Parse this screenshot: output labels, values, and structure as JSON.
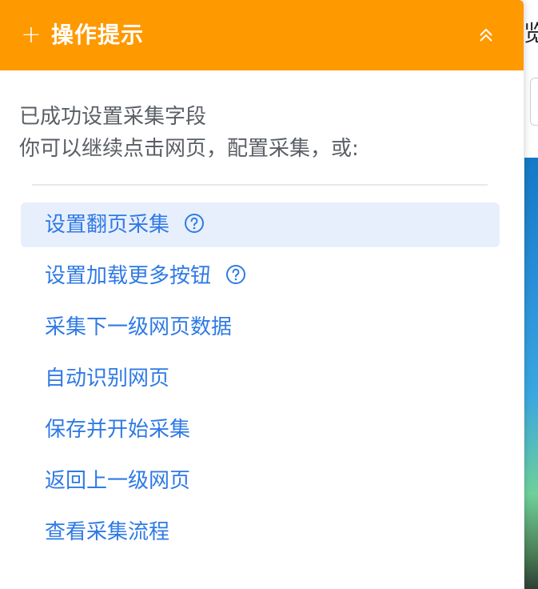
{
  "background": {
    "heading_fragment": "览"
  },
  "panel": {
    "header": {
      "plus_icon": "plus-icon",
      "title": "操作提示",
      "collapse_icon": "double-chevron-up-icon",
      "accent_color": "#ff9900"
    },
    "intro": {
      "line1": "已成功设置采集字段",
      "line2": "你可以继续点击网页，配置采集，或:"
    },
    "actions": [
      {
        "label": "设置翻页采集",
        "has_help": true,
        "active": true
      },
      {
        "label": "设置加载更多按钮",
        "has_help": true,
        "active": false
      },
      {
        "label": "采集下一级网页数据",
        "has_help": false,
        "active": false
      },
      {
        "label": "自动识别网页",
        "has_help": false,
        "active": false
      },
      {
        "label": "保存并开始采集",
        "has_help": false,
        "active": false
      },
      {
        "label": "返回上一级网页",
        "has_help": false,
        "active": false
      },
      {
        "label": "查看采集流程",
        "has_help": false,
        "active": false
      }
    ],
    "link_color": "#2f7ae5",
    "highlight_color": "#e8effc"
  }
}
